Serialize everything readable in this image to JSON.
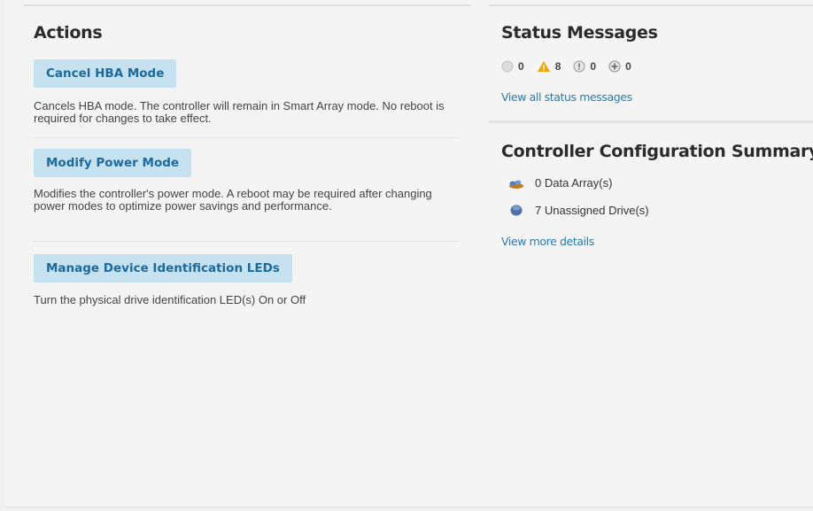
{
  "actions": {
    "heading": "Actions",
    "items": [
      {
        "button": "Cancel HBA Mode",
        "description": "Cancels HBA mode. The controller will remain in Smart Array mode. No reboot is required for changes to take effect."
      },
      {
        "button": "Modify Power Mode",
        "description": "Modifies the controller's power mode. A reboot may be required after changing power modes to optimize power savings and performance."
      },
      {
        "button": "Manage Device Identification LEDs",
        "description": "Turn the physical drive identification LED(s) On or Off"
      }
    ]
  },
  "status": {
    "heading": "Status Messages",
    "counts": [
      {
        "icon": "info-circle-icon",
        "value": "0"
      },
      {
        "icon": "warning-triangle-icon",
        "value": "8"
      },
      {
        "icon": "error-circle-icon",
        "value": "0"
      },
      {
        "icon": "critical-circle-icon",
        "value": "0"
      }
    ],
    "link": "View all status messages",
    "colors": {
      "warning": "#f0a500",
      "muted": "#c4c4c4"
    }
  },
  "summary": {
    "heading": "Controller Configuration Summary",
    "rows": [
      {
        "icon": "data-array-icon",
        "text": "0 Data Array(s)"
      },
      {
        "icon": "unassigned-drive-icon",
        "text": "7 Unassigned Drive(s)"
      }
    ],
    "link": "View more details"
  },
  "colors": {
    "button_bg": "#c6e2f1",
    "button_text": "#1c6a9c",
    "link": "#2a7ab0"
  }
}
